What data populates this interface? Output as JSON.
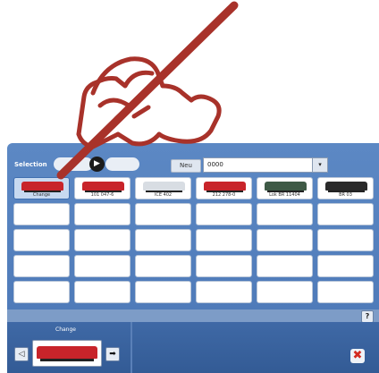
{
  "toolbar": {
    "selection_label": "Selection",
    "right_label": "",
    "neu_label": "Neu",
    "combo_value": "0000",
    "combo_arrow": "▾"
  },
  "grid": {
    "rows": [
      [
        {
          "label": "Change",
          "color": "#c8242a",
          "selected": true
        },
        {
          "label": "101 047-6",
          "color": "#c8242a",
          "selected": false
        },
        {
          "label": "ICE 402",
          "color": "#d8dde3",
          "selected": false
        },
        {
          "label": "212 278-0",
          "color": "#c8242a",
          "selected": false
        },
        {
          "label": "Lok BR 11404",
          "color": "#3f5a46",
          "selected": false
        },
        {
          "label": "BR 03",
          "color": "#2a2a2a",
          "selected": false
        }
      ],
      [
        {
          "label": "",
          "color": "",
          "selected": false
        },
        {
          "label": "",
          "color": "",
          "selected": false
        },
        {
          "label": "",
          "color": "",
          "selected": false
        },
        {
          "label": "",
          "color": "",
          "selected": false
        },
        {
          "label": "",
          "color": "",
          "selected": false
        },
        {
          "label": "",
          "color": "",
          "selected": false
        }
      ],
      [
        {
          "label": "",
          "color": "",
          "selected": false
        },
        {
          "label": "",
          "color": "",
          "selected": false
        },
        {
          "label": "",
          "color": "",
          "selected": false
        },
        {
          "label": "",
          "color": "",
          "selected": false
        },
        {
          "label": "",
          "color": "",
          "selected": false
        },
        {
          "label": "",
          "color": "",
          "selected": false
        }
      ],
      [
        {
          "label": "",
          "color": "",
          "selected": false
        },
        {
          "label": "",
          "color": "",
          "selected": false
        },
        {
          "label": "",
          "color": "",
          "selected": false
        },
        {
          "label": "",
          "color": "",
          "selected": false
        },
        {
          "label": "",
          "color": "",
          "selected": false
        },
        {
          "label": "",
          "color": "",
          "selected": false
        }
      ],
      [
        {
          "label": "",
          "color": "",
          "selected": false
        },
        {
          "label": "",
          "color": "",
          "selected": false
        },
        {
          "label": "",
          "color": "",
          "selected": false
        },
        {
          "label": "",
          "color": "",
          "selected": false
        },
        {
          "label": "",
          "color": "",
          "selected": false
        },
        {
          "label": "",
          "color": "",
          "selected": false
        }
      ]
    ]
  },
  "statusbar": {
    "help_label": "?"
  },
  "bottom": {
    "change_label": "Change",
    "prev_icon": "chevron-left-icon",
    "prev_glyph": "◁",
    "next_icon": "arrow-right-icon",
    "next_glyph": "➡",
    "close_icon": "close-icon",
    "close_glyph": "✖"
  },
  "overlay": {
    "icon": "hand-with-pen-icon",
    "stroke_color": "#a8322a"
  },
  "colors": {
    "panel": "#5c88c4",
    "bottom": "#3f69a6",
    "accent_red": "#c8242a"
  }
}
